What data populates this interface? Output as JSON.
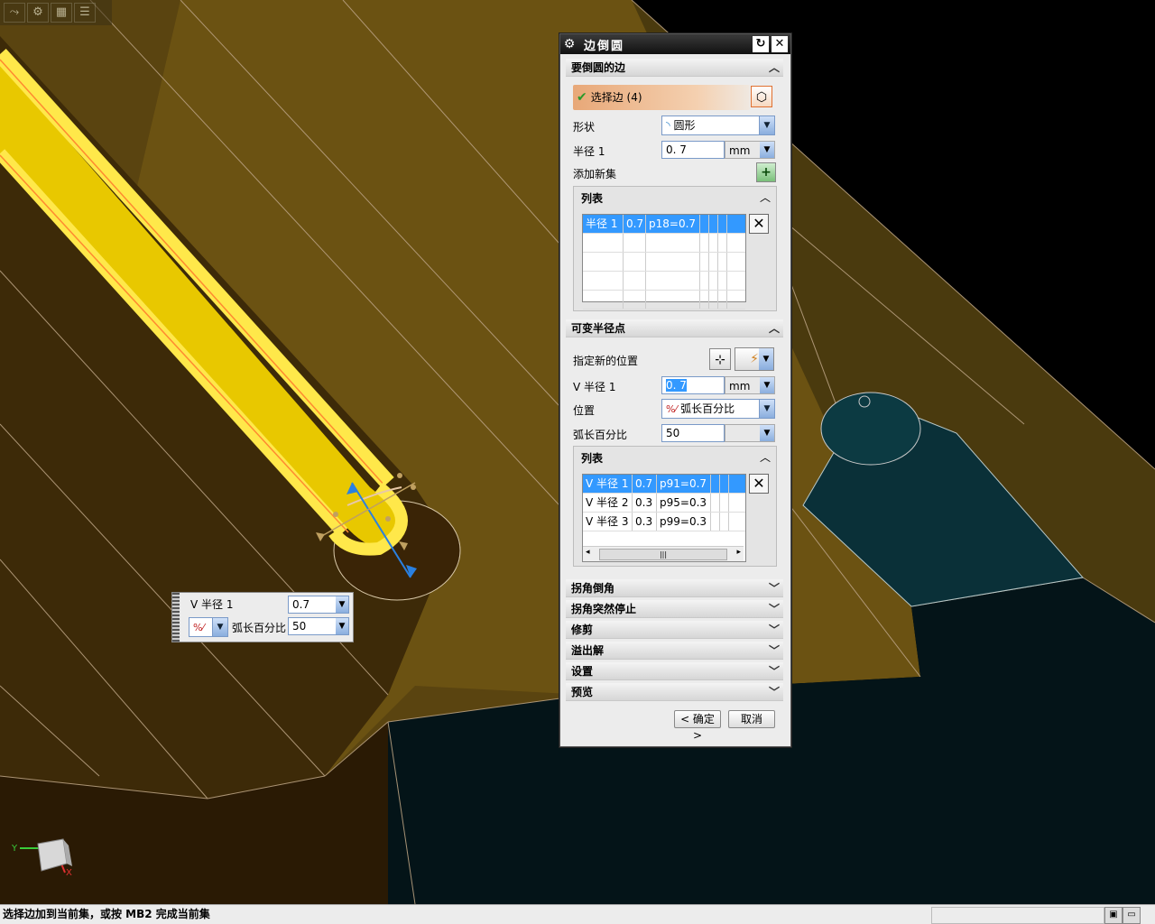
{
  "toolbar": {
    "icons": [
      "snap-icon",
      "gear-icon",
      "grid-icon",
      "list-icon"
    ]
  },
  "triad": {
    "y_label": "Y",
    "x_label": "X"
  },
  "dialog": {
    "title": "边倒圆",
    "sec_edges": "要倒圆的边",
    "select_edges": "选择边 (4)",
    "shape_label": "形状",
    "shape_value": "圆形",
    "radius_label": "半径 1",
    "radius_value": "0. 7",
    "unit": "mm",
    "add_set_label": "添加新集",
    "list_label": "列表",
    "list1_rows": [
      {
        "c1": "半径 1",
        "c2": "0.7",
        "c3": "p18=0.7"
      }
    ],
    "sec_var": "可变半径点",
    "new_pos_label": "指定新的位置",
    "v_radius_label": "V 半径 1",
    "v_radius_value": "0. 7",
    "position_label": "位置",
    "position_value": "弧长百分比",
    "arc_pct_label": "弧长百分比",
    "arc_pct_value": "50",
    "list2_label": "列表",
    "list2_rows": [
      {
        "c1": "V 半径 1",
        "c2": "0.7",
        "c3": "p91=0.7"
      },
      {
        "c1": "V 半径 2",
        "c2": "0.3",
        "c3": "p95=0.3"
      },
      {
        "c1": "V 半径 3",
        "c2": "0.3",
        "c3": "p99=0.3"
      }
    ],
    "collapsed": [
      "拐角倒角",
      "拐角突然停止",
      "修剪",
      "溢出解",
      "设置",
      "预览"
    ],
    "ok": "< 确定 >",
    "cancel": "取消"
  },
  "float": {
    "v_radius_label": "V 半径 1",
    "v_radius_value": "0.7",
    "arc_pct_label": "弧长百分比",
    "arc_pct_value": "50"
  },
  "status": {
    "message": "选择边加到当前集，或按 MB2 完成当前集"
  }
}
